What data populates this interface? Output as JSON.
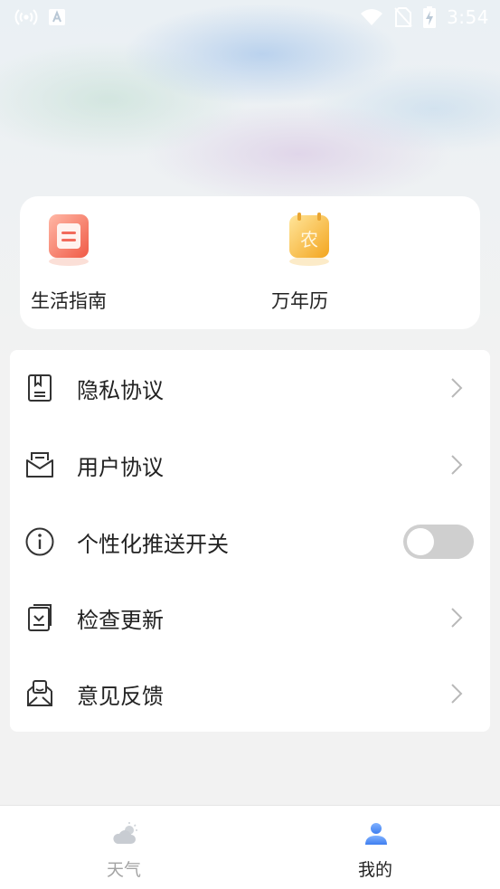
{
  "status_bar": {
    "time": "3:54",
    "left_icons": [
      "hotspot-icon",
      "keyboard-a-icon"
    ],
    "right_icons": [
      "wifi-icon",
      "no-sim-icon",
      "battery-charging-icon"
    ]
  },
  "quick_links": [
    {
      "label": "生活指南",
      "icon": "life-guide-icon",
      "color": "#f26b5b"
    },
    {
      "label": "万年历",
      "icon": "calendar-icon",
      "icon_text": "农",
      "color": "#f5b83a"
    }
  ],
  "menu": {
    "items": [
      {
        "label": "隐私协议",
        "icon": "document-icon",
        "action": "chevron"
      },
      {
        "label": "用户协议",
        "icon": "envelope-icon",
        "action": "chevron"
      },
      {
        "label": "个性化推送开关",
        "icon": "info-icon",
        "action": "toggle",
        "toggle_on": false
      },
      {
        "label": "检查更新",
        "icon": "download-doc-icon",
        "action": "chevron"
      },
      {
        "label": "意见反馈",
        "icon": "feedback-mail-icon",
        "action": "chevron"
      }
    ]
  },
  "tabbar": {
    "tabs": [
      {
        "label": "天气",
        "icon": "weather-icon",
        "active": false
      },
      {
        "label": "我的",
        "icon": "user-icon",
        "active": true
      }
    ],
    "active_color": "#3f7ff0",
    "inactive_color": "#a3a3a3"
  }
}
